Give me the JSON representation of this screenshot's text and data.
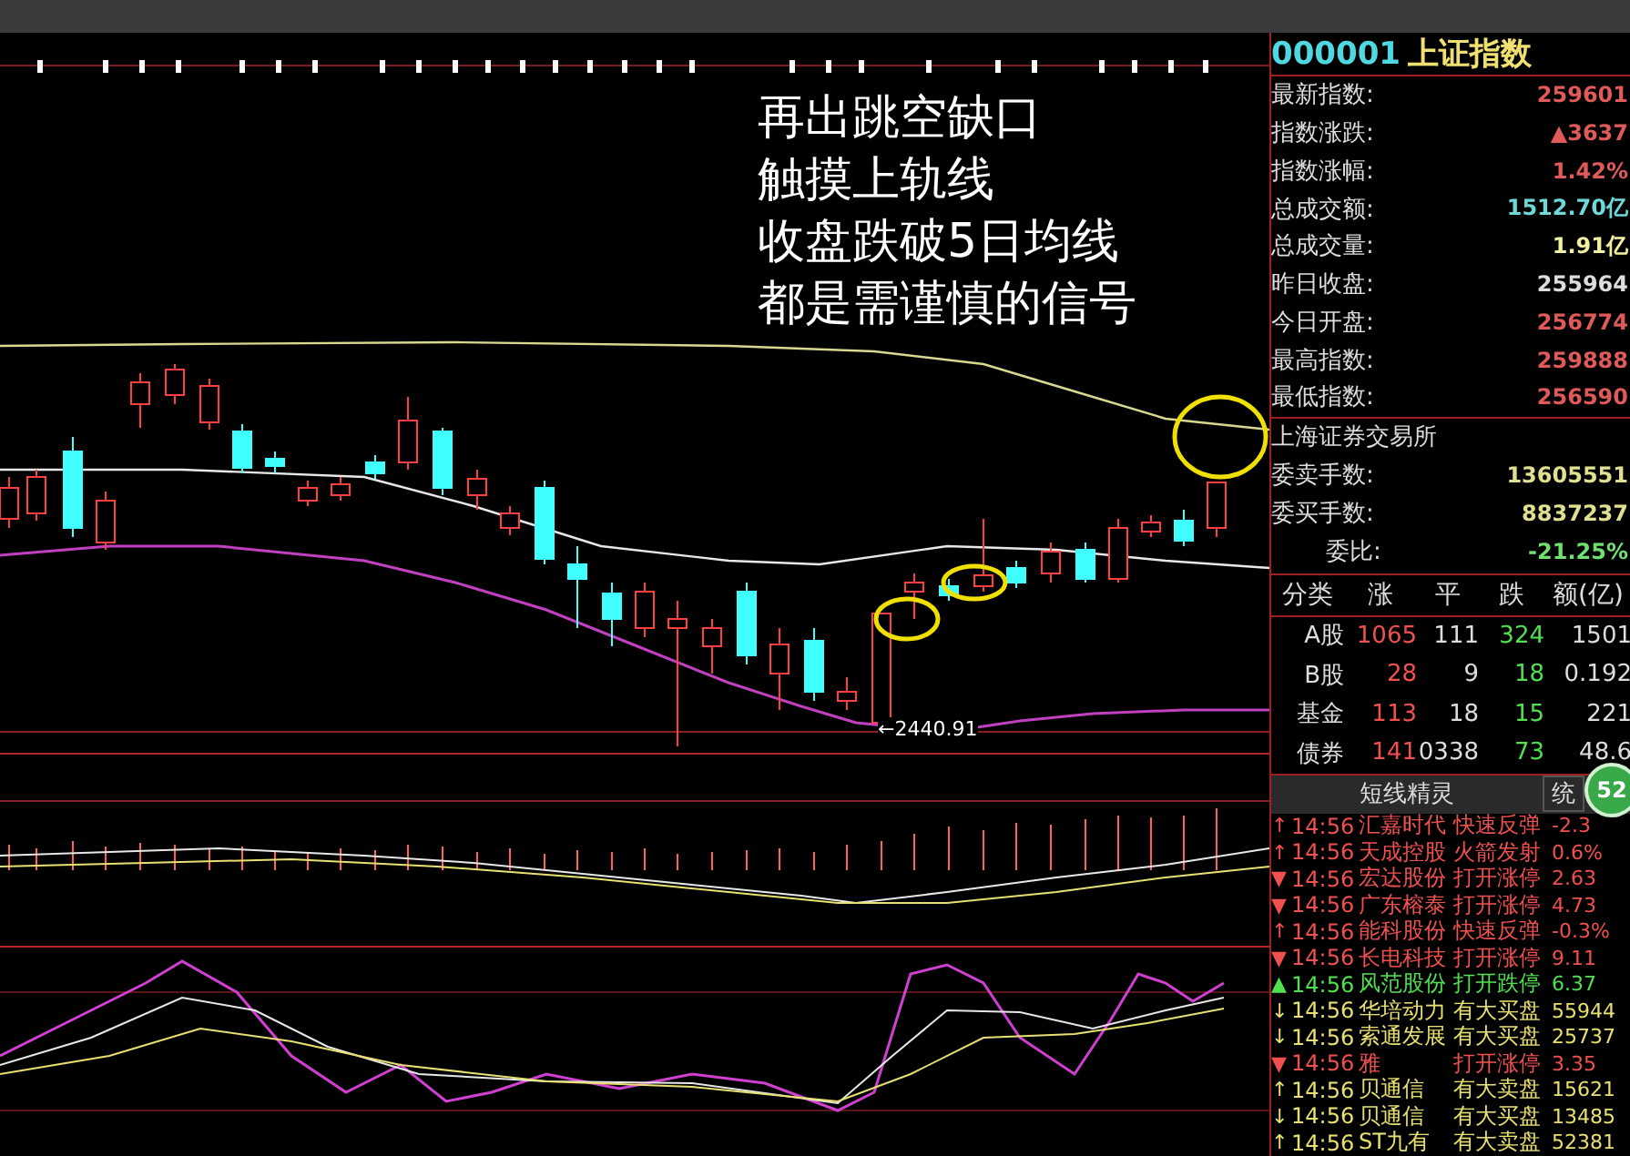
{
  "chart": {
    "annotation": [
      "再出跳空缺口",
      "触摸上轨线",
      "收盘跌破5日均线",
      "都是需谨慎的信号"
    ],
    "low_label": "←2440.91"
  },
  "quote": {
    "code": "000001",
    "name": "上证指数",
    "rows": [
      {
        "label": "最新指数:",
        "value": "259601",
        "color": "#e05a5a"
      },
      {
        "label": "指数涨跌:",
        "value": "▲3637",
        "color": "#e05a5a"
      },
      {
        "label": "指数涨幅:",
        "value": "1.42%",
        "color": "#e05a5a"
      },
      {
        "label": "总成交额:",
        "value": "1512.70亿",
        "color": "#6fd8d8"
      },
      {
        "label": "总成交量:",
        "value": "1.91亿",
        "color": "#f0f0a0"
      },
      {
        "label": "昨日收盘:",
        "value": "255964",
        "color": "#dddddd"
      },
      {
        "label": "今日开盘:",
        "value": "256774",
        "color": "#e05a5a"
      },
      {
        "label": "最高指数:",
        "value": "259888",
        "color": "#e05a5a"
      },
      {
        "label": "最低指数:",
        "value": "256590",
        "color": "#e05a5a"
      }
    ]
  },
  "exchange": "上海证券交易所",
  "orders": [
    {
      "label": "委卖手数:",
      "value": "13605551",
      "color": "#e0e090",
      "kind": "plain"
    },
    {
      "label": "委买手数:",
      "value": "8837237",
      "color": "#e0e090",
      "kind": "plain"
    },
    {
      "label": "委比:",
      "value": "-21.25%",
      "color": "#70e070",
      "kind": "ratio"
    }
  ],
  "breadth": {
    "columns": [
      "分类",
      "涨",
      "平",
      "跌",
      "额(亿)"
    ],
    "rows": [
      [
        "A股",
        "1065",
        "111",
        "324",
        "1501"
      ],
      [
        "B股",
        "28",
        "9",
        "18",
        "0.192"
      ],
      [
        "基金",
        "113",
        "18",
        "15",
        "221"
      ],
      [
        "债券",
        "141",
        "0338",
        "73",
        "48.6"
      ]
    ]
  },
  "alerts": {
    "title": "短线精灵",
    "tab": "统",
    "badge": "52",
    "rows": [
      {
        "mark": "↑",
        "time": "14:56",
        "name": "汇嘉时代",
        "action": "快速反弹",
        "value": "-2.3",
        "color": "#f05050"
      },
      {
        "mark": "↑",
        "time": "14:56",
        "name": "天成控股",
        "action": "火箭发射",
        "value": "0.6%",
        "color": "#f05050"
      },
      {
        "mark": "▼",
        "time": "14:56",
        "name": "宏达股份",
        "action": "打开涨停",
        "value": "2.63",
        "color": "#f05050"
      },
      {
        "mark": "▼",
        "time": "14:56",
        "name": "广东榕泰",
        "action": "打开涨停",
        "value": "4.73",
        "color": "#f05050"
      },
      {
        "mark": "↑",
        "time": "14:56",
        "name": "能科股份",
        "action": "快速反弹",
        "value": "-0.3%",
        "color": "#f05050"
      },
      {
        "mark": "▼",
        "time": "14:56",
        "name": "长电科技",
        "action": "打开涨停",
        "value": "9.11",
        "color": "#f05050"
      },
      {
        "mark": "▲",
        "time": "14:56",
        "name": "风范股份",
        "action": "打开跌停",
        "value": "6.37",
        "color": "#50e050"
      },
      {
        "mark": "↓",
        "time": "14:56",
        "name": "华培动力",
        "action": "有大买盘",
        "value": "55944",
        "color": "#e8e070"
      },
      {
        "mark": "↓",
        "time": "14:56",
        "name": "索通发展",
        "action": "有大买盘",
        "value": "25737",
        "color": "#e8e070"
      },
      {
        "mark": "▼",
        "time": "14:56",
        "name": "雅",
        "action": "打开涨停",
        "value": "3.35",
        "color": "#f05050"
      },
      {
        "mark": "↑",
        "time": "14:56",
        "name": "贝通信",
        "action": "有大卖盘",
        "value": "15621",
        "color": "#e8e070"
      },
      {
        "mark": "↓",
        "time": "14:56",
        "name": "贝通信",
        "action": "有大买盘",
        "value": "13485",
        "color": "#e8e070"
      },
      {
        "mark": "↑",
        "time": "14:56",
        "name": "ST九有",
        "action": "有大卖盘",
        "value": "52381",
        "color": "#e8e070"
      }
    ]
  }
}
